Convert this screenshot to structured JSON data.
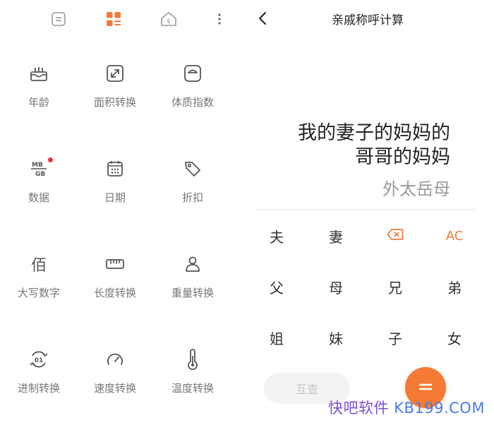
{
  "left_panel": {
    "topbar_icons": [
      "list-icon",
      "grid-icon",
      "currency-house-icon",
      "more-vert-icon"
    ],
    "tools": [
      {
        "label": "年龄",
        "icon": "cake-icon"
      },
      {
        "label": "面积转换",
        "icon": "resize-icon"
      },
      {
        "label": "体质指数",
        "icon": "scale-icon"
      },
      {
        "label": "数据",
        "icon": "mb-gb-icon",
        "badge": true
      },
      {
        "label": "日期",
        "icon": "calendar-icon"
      },
      {
        "label": "折扣",
        "icon": "tag-icon"
      },
      {
        "label": "大写数字",
        "icon": "bai-char-icon",
        "glyph": "佰"
      },
      {
        "label": "长度转换",
        "icon": "ruler-icon"
      },
      {
        "label": "重量转换",
        "icon": "person-icon"
      },
      {
        "label": "进制转换",
        "icon": "binary-icon"
      },
      {
        "label": "速度转换",
        "icon": "speedometer-icon"
      },
      {
        "label": "温度转换",
        "icon": "thermometer-icon"
      }
    ],
    "data_icon_text": {
      "top": "MB",
      "bottom": "GB"
    }
  },
  "right_panel": {
    "title": "亲戚称呼计算",
    "expression_line1": "我的妻子的妈妈的",
    "expression_line2": "哥哥的妈妈",
    "result": "外太岳母",
    "keys": [
      [
        "夫",
        "妻",
        "⌫",
        "AC"
      ],
      [
        "父",
        "母",
        "兄",
        "弟"
      ],
      [
        "姐",
        "妹",
        "子",
        "女"
      ]
    ],
    "mutual_button": "互查",
    "equals_icon": "equals-icon"
  },
  "watermark": {
    "part1": "快吧软件",
    "part2": "KB199.COM"
  },
  "colors": {
    "accent": "#f47a36",
    "badge": "#e8323e"
  }
}
